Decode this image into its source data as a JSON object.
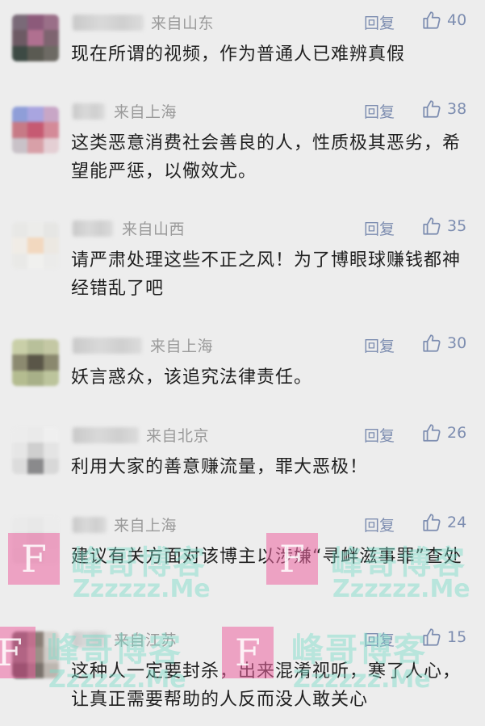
{
  "reply_label": "回复",
  "comments": [
    {
      "location": "来自山东",
      "likes": "40",
      "text": "现在所谓的视频，作为普通人已难辨真假",
      "avatar_colors": [
        "#7a6a78",
        "#8c5a7a",
        "#9a6f88",
        "#6d5a64",
        "#b07090",
        "#7e6470",
        "#3d4a44",
        "#5a5a52",
        "#6d6a64"
      ]
    },
    {
      "location": "来自上海",
      "likes": "38",
      "text": "这类恶意消费社会善良的人，性质极其恶劣，希望能严惩，以儆效尤。",
      "avatar_colors": [
        "#8f9ed8",
        "#a9a5e0",
        "#c8a6c6",
        "#c77a86",
        "#c65a72",
        "#d48a98",
        "#c9c2c8",
        "#d8a0a8",
        "#e4cfd4"
      ]
    },
    {
      "location": "来自山西",
      "likes": "35",
      "text": "请严肃处理这些不正之风！为了博眼球赚钱都神经错乱了吧",
      "avatar_colors": [
        "#e8e8e6",
        "#ececea",
        "#e6e6e4",
        "#f0ece6",
        "#f2d8bf",
        "#ece8e2",
        "#e9e9e7",
        "#f0f0ee",
        "#ebebea"
      ]
    },
    {
      "location": "来自上海",
      "likes": "30",
      "text": "妖言惑众，该追究法律责任。",
      "avatar_colors": [
        "#c9cfa8",
        "#b8c09a",
        "#c4c8a4",
        "#8c8a70",
        "#5a5648",
        "#8a886e",
        "#b4bc90",
        "#a8b088",
        "#bcc49c"
      ]
    },
    {
      "location": "来自北京",
      "likes": "26",
      "text": "利用大家的善意赚流量，罪大恶极！",
      "avatar_colors": [
        "#ececec",
        "#eaeaea",
        "#efefef",
        "#e6e6e6",
        "#cfcfcf",
        "#e4e4e4",
        "#dcdcdc",
        "#8a8a8c",
        "#d8d8d8"
      ]
    },
    {
      "location": "来自上海",
      "likes": "24",
      "text": "建议有关方面对该博主以涉嫌“寻衅滋事罪”查处",
      "avatar_colors": [
        "#eaeaea",
        "#e8e8e8",
        "#ececec",
        "#e4e4e4",
        "#dedede",
        "#e6e6e6",
        "#e2e2e2",
        "#e0e0e0",
        "#e8e8e8"
      ]
    },
    {
      "location": "来自江苏",
      "likes": "15",
      "text": "这种人一定要封杀，出来混淆视听，寒了人心，让真正需要帮助的人反而没人敢关心",
      "avatar_colors": [
        "#5e5a58",
        "#8a7e76",
        "#d4d0cc",
        "#6a6462",
        "#9c9088",
        "#cfcac6",
        "#403c3a",
        "#7a726c",
        "#bdb6b0"
      ]
    }
  ],
  "watermark": {
    "logo_letter": "F",
    "cn": "峰哥博客",
    "en": "Zzzzzz.Me"
  }
}
